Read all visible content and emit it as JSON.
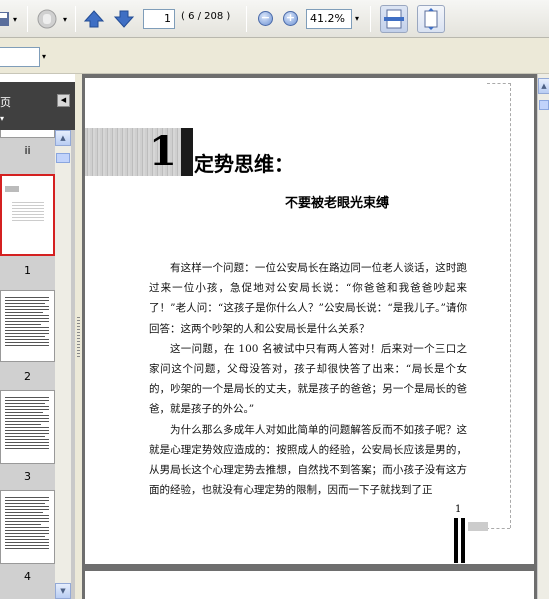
{
  "toolbar": {
    "page_number": "1",
    "page_count": "( 6 / 208 )",
    "zoom": "41.2%",
    "zoom_out": "−",
    "zoom_in": "+"
  },
  "navpane": {
    "title": "页",
    "options": "▾",
    "collapse": "◀",
    "thumbnails": [
      {
        "label": "ii"
      },
      {
        "label": "1"
      },
      {
        "label": "2"
      },
      {
        "label": "3"
      },
      {
        "label": "4"
      }
    ]
  },
  "document": {
    "chapter_number": "1",
    "chapter_title": "定势思维：",
    "subtitle": "不要被老眼光束缚",
    "paragraphs": [
      "有这样一个问题：一位公安局长在路边同一位老人谈话，这时跑过来一位小孩，急促地对公安局长说：“你爸爸和我爸爸吵起来了！”老人问：“这孩子是你什么人？”公安局长说：“是我儿子。”请你回答：这两个吵架的人和公安局长是什么关系？",
      "这一问题，在 100 名被试中只有两人答对！后来对一个三口之家问这个问题，父母没答对，孩子却很快答了出来：“局长是个女的，吵架的一个是局长的丈夫，就是孩子的爸爸；另一个是局长的爸爸，就是孩子的外公。”",
      "为什么那么多成年人对如此简单的问题解答反而不如孩子呢？这就是心理定势效应造成的：按照成人的经验，公安局长应该是男的，从男局长这个心理定势去推想，自然找不到答案；而小孩子没有这方面的经验，也就没有心理定势的限制，因而一下子就找到了正"
    ],
    "page_footer_number": "1"
  }
}
